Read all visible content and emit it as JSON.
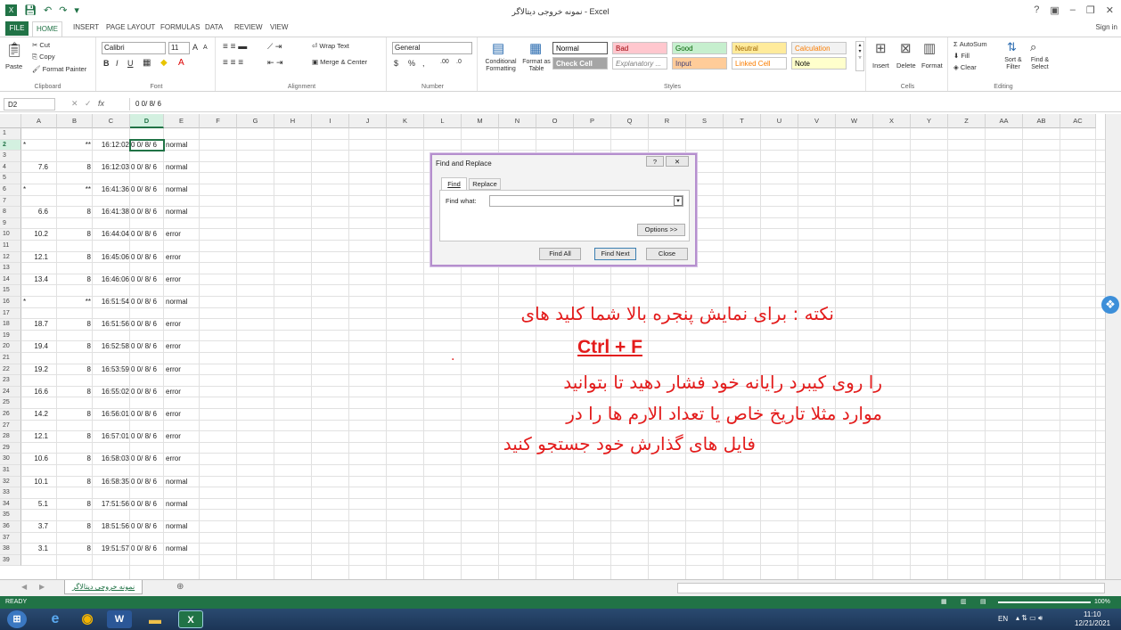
{
  "title_bar": {
    "title": "نمونه خروجی دیتالاگر - Excel",
    "help": "?",
    "ribbon_opts": "▣",
    "minimize": "–",
    "restore": "❐",
    "close": "✕"
  },
  "tabs": {
    "file": "FILE",
    "home": "HOME",
    "items": [
      "INSERT",
      "PAGE LAYOUT",
      "FORMULAS",
      "DATA",
      "REVIEW",
      "VIEW"
    ],
    "signin": "Sign in"
  },
  "ribbon": {
    "clipboard": {
      "paste": "Paste",
      "cut": "Cut",
      "copy": "Copy",
      "format_painter": "Format Painter",
      "label": "Clipboard"
    },
    "font": {
      "name": "Calibri",
      "size": "11",
      "grow": "A",
      "shrink": "A",
      "bold": "B",
      "italic": "I",
      "underline": "U",
      "label": "Font"
    },
    "alignment": {
      "wrap": "Wrap Text",
      "merge": "Merge & Center",
      "label": "Alignment"
    },
    "number": {
      "format": "General",
      "currency": "$",
      "percent": "%",
      "comma": ",",
      "inc_dec": ".00",
      "dec_dec": ".0",
      "label": "Number"
    },
    "styles": {
      "cond": "Conditional Formatting",
      "format_table": "Format as Table",
      "items": [
        {
          "name": "Normal",
          "bg": "#ffffff",
          "fg": "#000000"
        },
        {
          "name": "Bad",
          "bg": "#ffc7ce",
          "fg": "#9c0006"
        },
        {
          "name": "Good",
          "bg": "#c6efce",
          "fg": "#006100"
        },
        {
          "name": "Neutral",
          "bg": "#ffeb9c",
          "fg": "#9c6500"
        },
        {
          "name": "Calculation",
          "bg": "#f2f2f2",
          "fg": "#fa7d00"
        },
        {
          "name": "Check Cell",
          "bg": "#a5a5a5",
          "fg": "#ffffff"
        },
        {
          "name": "Explanatory ...",
          "bg": "#ffffff",
          "fg": "#7f7f7f"
        },
        {
          "name": "Input",
          "bg": "#ffcc99",
          "fg": "#3f3f76"
        },
        {
          "name": "Linked Cell",
          "bg": "#ffffff",
          "fg": "#fa7d00"
        },
        {
          "name": "Note",
          "bg": "#ffffcc",
          "fg": "#000000"
        }
      ],
      "label": "Styles"
    },
    "cells": {
      "insert": "Insert",
      "delete": "Delete",
      "format": "Format",
      "label": "Cells"
    },
    "editing": {
      "autosum": "AutoSum",
      "fill": "Fill",
      "clear": "Clear",
      "sort": "Sort & Filter",
      "find": "Find & Select",
      "label": "Editing"
    }
  },
  "formula_bar": {
    "name_box": "D2",
    "cancel": "✕",
    "enter": "✓",
    "fx": "fx",
    "value": "0 0/ 8/ 6"
  },
  "columns": [
    "A",
    "B",
    "C",
    "D",
    "E",
    "F",
    "G",
    "H",
    "I",
    "J",
    "K",
    "L",
    "M",
    "N",
    "O",
    "P",
    "Q",
    "R",
    "S",
    "T",
    "U",
    "V",
    "W",
    "X",
    "Y",
    "Z",
    "AA",
    "AB",
    "AC"
  ],
  "rows": [
    {
      "n": "1"
    },
    {
      "n": "2",
      "a": "*",
      "b": "**",
      "c": "16:12:02",
      "d": "0 0/ 8/ 6",
      "e": "normal"
    },
    {
      "n": "3"
    },
    {
      "n": "4",
      "a": "7.6",
      "b": "8",
      "c": "16:12:03",
      "d": "0 0/ 8/ 6",
      "e": "normal"
    },
    {
      "n": "5"
    },
    {
      "n": "6",
      "a": "*",
      "b": "**",
      "c": "16:41:36",
      "d": "0 0/ 8/ 6",
      "e": "normal"
    },
    {
      "n": "7"
    },
    {
      "n": "8",
      "a": "6.6",
      "b": "8",
      "c": "16:41:38",
      "d": "0 0/ 8/ 6",
      "e": "normal"
    },
    {
      "n": "9"
    },
    {
      "n": "10",
      "a": "10.2",
      "b": "8",
      "c": "16:44:04",
      "d": "0 0/ 8/ 6",
      "e": "error"
    },
    {
      "n": "11"
    },
    {
      "n": "12",
      "a": "12.1",
      "b": "8",
      "c": "16:45:06",
      "d": "0 0/ 8/ 6",
      "e": "error"
    },
    {
      "n": "13"
    },
    {
      "n": "14",
      "a": "13.4",
      "b": "8",
      "c": "16:46:06",
      "d": "0 0/ 8/ 6",
      "e": "error"
    },
    {
      "n": "15"
    },
    {
      "n": "16",
      "a": "*",
      "b": "**",
      "c": "16:51:54",
      "d": "0 0/ 8/ 6",
      "e": "normal"
    },
    {
      "n": "17"
    },
    {
      "n": "18",
      "a": "18.7",
      "b": "8",
      "c": "16:51:56",
      "d": "0 0/ 8/ 6",
      "e": "error"
    },
    {
      "n": "19"
    },
    {
      "n": "20",
      "a": "19.4",
      "b": "8",
      "c": "16:52:58",
      "d": "0 0/ 8/ 6",
      "e": "error"
    },
    {
      "n": "21"
    },
    {
      "n": "22",
      "a": "19.2",
      "b": "8",
      "c": "16:53:59",
      "d": "0 0/ 8/ 6",
      "e": "error"
    },
    {
      "n": "23"
    },
    {
      "n": "24",
      "a": "16.6",
      "b": "8",
      "c": "16:55:02",
      "d": "0 0/ 8/ 6",
      "e": "error"
    },
    {
      "n": "25"
    },
    {
      "n": "26",
      "a": "14.2",
      "b": "8",
      "c": "16:56:01",
      "d": "0 0/ 8/ 6",
      "e": "error"
    },
    {
      "n": "27"
    },
    {
      "n": "28",
      "a": "12.1",
      "b": "8",
      "c": "16:57:01",
      "d": "0 0/ 8/ 6",
      "e": "error"
    },
    {
      "n": "29"
    },
    {
      "n": "30",
      "a": "10.6",
      "b": "8",
      "c": "16:58:03",
      "d": "0 0/ 8/ 6",
      "e": "error"
    },
    {
      "n": "31"
    },
    {
      "n": "32",
      "a": "10.1",
      "b": "8",
      "c": "16:58:35",
      "d": "0 0/ 8/ 6",
      "e": "normal"
    },
    {
      "n": "33"
    },
    {
      "n": "34",
      "a": "5.1",
      "b": "8",
      "c": "17:51:56",
      "d": "0 0/ 8/ 6",
      "e": "normal"
    },
    {
      "n": "35"
    },
    {
      "n": "36",
      "a": "3.7",
      "b": "8",
      "c": "18:51:56",
      "d": "0 0/ 8/ 6",
      "e": "normal"
    },
    {
      "n": "37"
    },
    {
      "n": "38",
      "a": "3.1",
      "b": "8",
      "c": "19:51:57",
      "d": "0 0/ 8/ 6",
      "e": "normal"
    },
    {
      "n": "39"
    }
  ],
  "dialog": {
    "title": "Find and Replace",
    "help": "?",
    "close_x": "✕",
    "tab_find": "Find",
    "tab_replace": "Replace",
    "find_label": "Find what:",
    "find_value": "",
    "options": "Options >>",
    "find_all": "Find All",
    "find_next": "Find Next",
    "close": "Close"
  },
  "note": {
    "line1": "نکته : برای نمایش پنجره بالا شما کلید های",
    "line2": "Ctrl + F",
    "dot": ".",
    "line3": "را روی کیبرد رایانه خود فشار دهید تا بتوانید",
    "line4": "موارد مثلا تاریخ خاص یا تعداد الارم ها را در",
    "line5": "فایل های گذارش خود جستجو کنید",
    "color": "#e31b1b"
  },
  "sheet": {
    "tab": "نمونه خروجی دیتالاگر",
    "add": "⊕"
  },
  "status": {
    "ready": "READY",
    "zoom": "100%"
  },
  "taskbar": {
    "lang": "EN",
    "time": "11:10",
    "date": "12/21/2021"
  }
}
